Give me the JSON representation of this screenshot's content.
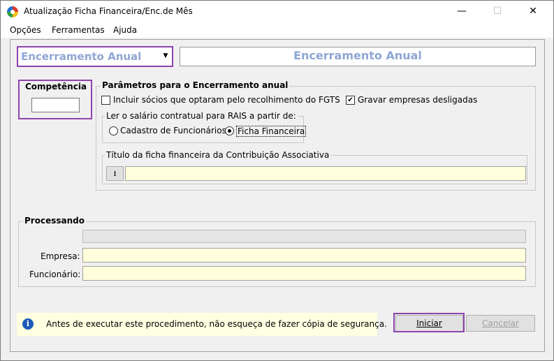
{
  "window": {
    "title": "Atualização Ficha Financeira/Enc.de Mês",
    "minimize": "—",
    "maximize": "☐",
    "close": "✕"
  },
  "menu": {
    "items": [
      "Opções",
      "Ferramentas",
      "Ajuda"
    ]
  },
  "mode_select": {
    "value": "Encerramento Anual",
    "arrow": "▼"
  },
  "header": {
    "title": "Encerramento Anual"
  },
  "competencia": {
    "label": "Competência",
    "value": ""
  },
  "params": {
    "label": "Parâmetros para o Encerramento anual",
    "incluir_socios": {
      "label": "Incluir sócios que optaram pelo recolhimento do FGTS",
      "checked": false
    },
    "gravar_empresas": {
      "label": "Gravar empresas desligadas",
      "checked": true,
      "mark": "✔"
    },
    "salario_group": {
      "label": "Ler o salário contratual para RAIS a partir de:",
      "options": [
        "Cadastro de Funcionários",
        "Ficha Financeira"
      ],
      "selected": "Ficha Financeira"
    },
    "titulo_group": {
      "label": "Título da ficha financeira da Contribuição Associativa",
      "button_glyph": "⭳",
      "value": ""
    }
  },
  "processando": {
    "label": "Processando",
    "progress": 0,
    "empresa_label": "Empresa:",
    "empresa_value": "",
    "funcionario_label": "Funcionário:",
    "funcionario_value": ""
  },
  "info": {
    "icon": "info-icon",
    "text": "Antes de executar este procedimento, não esqueça de fazer cópia de segurança."
  },
  "buttons": {
    "iniciar": "Iniciar",
    "cancelar": "Cancelar"
  },
  "colors": {
    "highlight": "#8e44ad",
    "title_blue": "#8fa6d4",
    "field_yellow": "#ffffdc"
  }
}
